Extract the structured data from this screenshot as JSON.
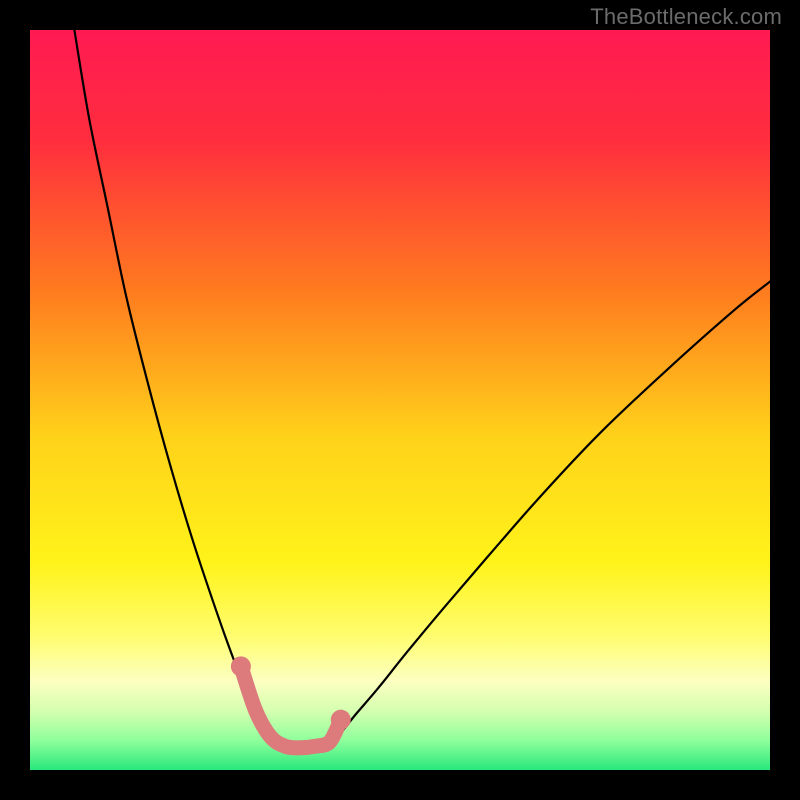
{
  "watermark": "TheBottleneck.com",
  "chart_data": {
    "type": "line",
    "title": "",
    "xlabel": "",
    "ylabel": "",
    "xlim": [
      0,
      100
    ],
    "ylim": [
      0,
      100
    ],
    "background_gradient": {
      "stops": [
        {
          "offset": 0.0,
          "color": "#ff1a52"
        },
        {
          "offset": 0.15,
          "color": "#ff2e3e"
        },
        {
          "offset": 0.35,
          "color": "#ff7a1f"
        },
        {
          "offset": 0.55,
          "color": "#ffd21a"
        },
        {
          "offset": 0.72,
          "color": "#fff31a"
        },
        {
          "offset": 0.82,
          "color": "#fffd70"
        },
        {
          "offset": 0.88,
          "color": "#fcffc1"
        },
        {
          "offset": 0.92,
          "color": "#d5ffb0"
        },
        {
          "offset": 0.96,
          "color": "#8fff9c"
        },
        {
          "offset": 1.0,
          "color": "#28e87c"
        }
      ]
    },
    "series": [
      {
        "name": "left-curve",
        "type": "line",
        "color": "#000000",
        "x": [
          6.0,
          8.0,
          10.5,
          13.0,
          16.0,
          19.0,
          22.0,
          25.0,
          27.5,
          29.5,
          31.0,
          32.5,
          34.0
        ],
        "y": [
          100.0,
          88.0,
          76.0,
          64.0,
          52.0,
          41.0,
          31.0,
          22.0,
          15.0,
          10.0,
          7.0,
          5.0,
          3.5
        ]
      },
      {
        "name": "right-curve",
        "type": "line",
        "color": "#000000",
        "x": [
          40.5,
          42.0,
          44.0,
          47.0,
          51.0,
          56.0,
          62.0,
          69.0,
          77.0,
          86.0,
          95.0,
          100.0
        ],
        "y": [
          3.5,
          5.0,
          7.5,
          11.0,
          16.0,
          22.0,
          29.0,
          37.0,
          45.5,
          54.0,
          62.0,
          66.0
        ]
      },
      {
        "name": "floor-line",
        "type": "line",
        "color": "#000000",
        "x": [
          34.0,
          36.0,
          38.0,
          40.5
        ],
        "y": [
          3.5,
          2.8,
          2.8,
          3.5
        ]
      },
      {
        "name": "highlight-band",
        "type": "line",
        "color": "#dd7a7b",
        "stroke_width": 15,
        "x": [
          28.5,
          30.5,
          32.5,
          34.5,
          36.5,
          38.5,
          40.5,
          42.0
        ],
        "y": [
          14.0,
          8.0,
          4.5,
          3.2,
          3.0,
          3.2,
          3.8,
          6.8
        ]
      },
      {
        "name": "highlight-dot-left",
        "type": "scatter",
        "color": "#dd7a7b",
        "radius": 10,
        "x": [
          28.5
        ],
        "y": [
          14.0
        ]
      },
      {
        "name": "highlight-dot-right",
        "type": "scatter",
        "color": "#dd7a7b",
        "radius": 10,
        "x": [
          42.0
        ],
        "y": [
          6.8
        ]
      }
    ]
  }
}
